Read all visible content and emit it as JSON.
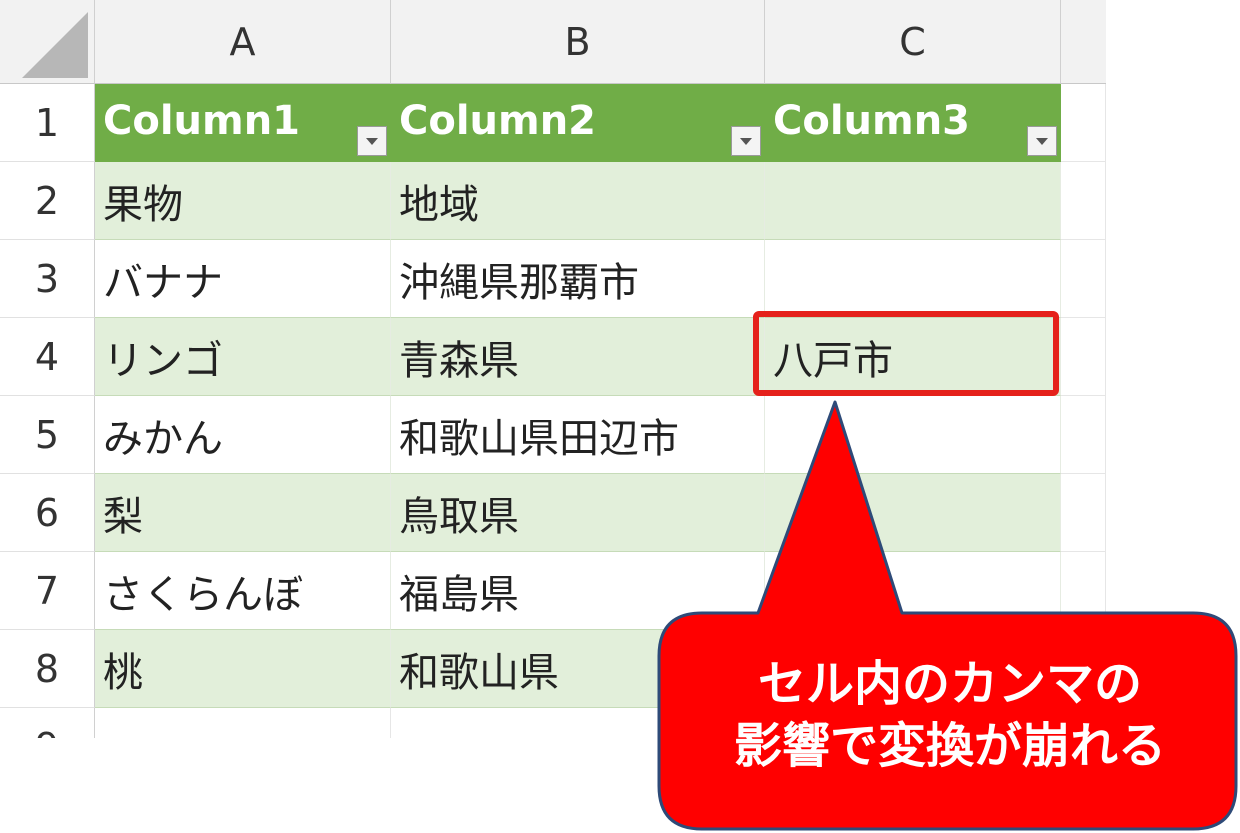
{
  "sheet": {
    "col_headers": [
      "A",
      "B",
      "C"
    ],
    "row_numbers": [
      "1",
      "2",
      "3",
      "4",
      "5",
      "6",
      "7",
      "8",
      "9"
    ],
    "table_headers": [
      "Column1",
      "Column2",
      "Column3"
    ],
    "rows": [
      [
        "果物",
        "地域",
        ""
      ],
      [
        "バナナ",
        "沖縄県那覇市",
        ""
      ],
      [
        "リンゴ",
        "青森県",
        "八戸市"
      ],
      [
        "みかん",
        "和歌山県田辺市",
        ""
      ],
      [
        "梨",
        "鳥取県",
        ""
      ],
      [
        "さくらんぼ",
        "福島県",
        ""
      ],
      [
        "桃",
        "和歌山県",
        ""
      ]
    ],
    "highlighted_cell": "C4"
  },
  "callout": {
    "line1": "セル内のカンマの",
    "line2": "影響で変換が崩れる"
  },
  "colors": {
    "table_header": "#70ad47",
    "band": "#e2efda",
    "highlight_border": "#e5211b",
    "callout_fill": "#ff0000",
    "callout_stroke": "#2e4a78"
  }
}
